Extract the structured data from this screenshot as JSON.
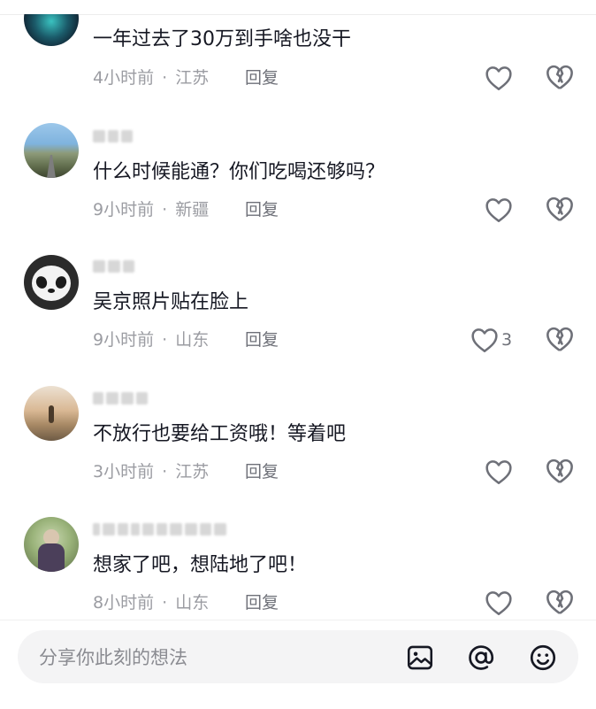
{
  "comments": [
    {
      "text": "一年过去了30万到手啥也没干",
      "time": "4小时前",
      "location": "江苏",
      "reply_label": "回复",
      "like_count": "",
      "avatar_colors": [
        "#0f1b2a",
        "#2a9fa5"
      ]
    },
    {
      "text": "什么时候能通？你们吃喝还够吗？",
      "time": "9小时前",
      "location": "新疆",
      "reply_label": "回复",
      "like_count": "",
      "avatar_colors": [
        "#7fb3de",
        "#6b7a5a"
      ]
    },
    {
      "text": "吴京照片贴在脸上",
      "time": "9小时前",
      "location": "山东",
      "reply_label": "回复",
      "like_count": "3",
      "avatar_colors": [
        "#2b2b2b",
        "#ffffff"
      ]
    },
    {
      "text": "不放行也要给工资哦！等着吧",
      "time": "3小时前",
      "location": "江苏",
      "reply_label": "回复",
      "like_count": "",
      "avatar_colors": [
        "#d9b894",
        "#6e5b45"
      ]
    },
    {
      "text": "想家了吧，想陆地了吧！",
      "time": "8小时前",
      "location": "山东",
      "reply_label": "回复",
      "like_count": "",
      "avatar_colors": [
        "#9ab37a",
        "#4b3f5a"
      ]
    }
  ],
  "meta_separator": "·",
  "input": {
    "placeholder": "分享你此刻的想法"
  },
  "icons": {
    "like": "heart-outline-icon",
    "dislike": "broken-heart-icon",
    "image": "image-icon",
    "mention": "at-icon",
    "emoji": "emoji-icon"
  },
  "colors": {
    "text_primary": "#161823",
    "text_secondary": "#9b9ca2",
    "icon_gray": "#6e7078",
    "input_bg": "#f4f4f5"
  }
}
